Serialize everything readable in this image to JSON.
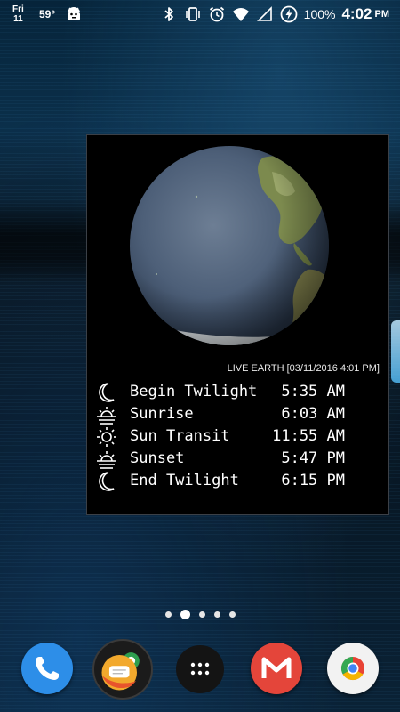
{
  "status_bar": {
    "day": "Fri",
    "date": "11",
    "temperature": "59°",
    "battery": "100%",
    "time": "4:02",
    "ampm": "PM",
    "icons": [
      "android-robot-icon",
      "bluetooth-icon",
      "vibrate-icon",
      "alarm-icon",
      "wifi-icon",
      "signal-icon",
      "battery-charging-icon"
    ]
  },
  "widget": {
    "caption": "LIVE EARTH [03/11/2016 4:01 PM]",
    "rows": [
      {
        "icon": "moon-icon",
        "label": "Begin Twilight",
        "time": "5:35 AM"
      },
      {
        "icon": "sunrise-icon",
        "label": "Sunrise",
        "time": "6:03 AM"
      },
      {
        "icon": "sun-icon",
        "label": "Sun Transit",
        "time": "11:55 AM"
      },
      {
        "icon": "sunset-icon",
        "label": "Sunset",
        "time": "5:47 PM"
      },
      {
        "icon": "moon-icon",
        "label": "End Twilight",
        "time": "6:15 PM"
      }
    ]
  },
  "pager": {
    "count": 5,
    "active": 1
  },
  "dock": [
    "phone-icon",
    "messenger-icon",
    "app-drawer-icon",
    "gmail-icon",
    "chrome-icon"
  ]
}
